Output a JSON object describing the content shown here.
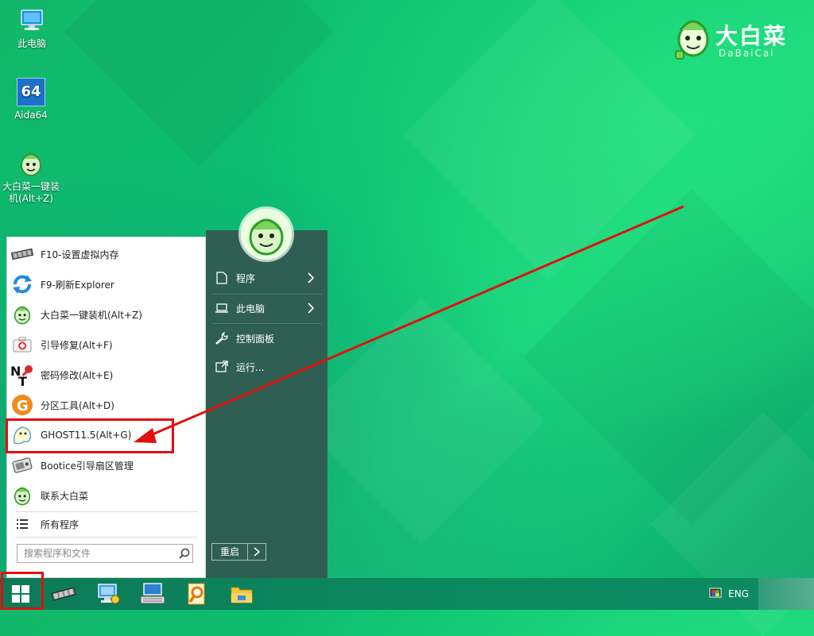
{
  "desktop": {
    "icons": [
      {
        "label": "此电脑"
      },
      {
        "label": "Aida64",
        "badge": "64"
      },
      {
        "label": "大白菜一键装机(Alt+Z)"
      }
    ]
  },
  "brand": {
    "title": "大白菜",
    "subtitle": "DaBaiCai"
  },
  "start_menu": {
    "left_items": [
      {
        "label": "F10-设置虚拟内存",
        "icon": "memory-chip-icon"
      },
      {
        "label": "F9-刷新Explorer",
        "icon": "refresh-icon"
      },
      {
        "label": "大白菜一键装机(Alt+Z)",
        "icon": "cabbage-icon"
      },
      {
        "label": "引导修复(Alt+F)",
        "icon": "first-aid-icon"
      },
      {
        "label": "密码修改(Alt+E)",
        "icon": "password-key-icon"
      },
      {
        "label": "分区工具(Alt+D)",
        "icon": "partition-tool-icon"
      },
      {
        "label": "GHOST11.5(Alt+G)",
        "icon": "ghost-icon"
      },
      {
        "label": "Bootice引导扇区管理",
        "icon": "disk-icon"
      },
      {
        "label": "联系大白菜",
        "icon": "cabbage-icon"
      }
    ],
    "all_programs": "所有程序",
    "search_placeholder": "搜索程序和文件",
    "right_items": [
      {
        "label": "程序",
        "has_arrow": true
      },
      {
        "label": "此电脑",
        "has_arrow": true
      },
      {
        "label": "控制面板",
        "has_arrow": false
      },
      {
        "label": "运行...",
        "has_arrow": false
      }
    ],
    "restart_label": "重启"
  },
  "taskbar": {
    "apps": [
      "start-icon",
      "memory-chip-icon",
      "network-icon",
      "keyboard-icon",
      "search-tool-icon",
      "file-explorer-icon"
    ],
    "lang": "ENG"
  },
  "colors": {
    "highlight": "#e01010",
    "right_panel": "#2f5f52",
    "taskbar": "#0c8b60"
  }
}
